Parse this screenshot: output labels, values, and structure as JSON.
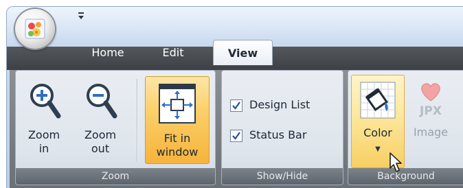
{
  "tabs": [
    {
      "label": "Home"
    },
    {
      "label": "Edit"
    },
    {
      "label": "View",
      "active": true
    }
  ],
  "groups": {
    "zoom": {
      "label": "Zoom",
      "buttons": {
        "zoom_in": "Zoom\nin",
        "zoom_out": "Zoom\nout",
        "fit_in_window": "Fit in\nwindow"
      }
    },
    "show_hide": {
      "label": "Show/Hide",
      "checkboxes": [
        {
          "label": "Design List",
          "checked": true
        },
        {
          "label": "Status Bar",
          "checked": true
        }
      ]
    },
    "background": {
      "label": "Background",
      "buttons": {
        "color": "Color",
        "image": "Image",
        "image_badge": "JPX"
      }
    }
  },
  "icons": {
    "orb": "flower-logo-icon",
    "qat": "customize-quick-access-arrow-icon",
    "zoom_in": "zoom-in-magnifier-icon",
    "zoom_out": "zoom-out-magnifier-icon",
    "fit": "fit-in-window-icon",
    "color": "paint-bucket-icon",
    "image": "heart-image-icon",
    "cursor": "mouse-pointer-icon"
  },
  "colors": {
    "active_button": "#f6b33a",
    "color_button": "#f7cf63",
    "tab_band": "#3d4044"
  }
}
